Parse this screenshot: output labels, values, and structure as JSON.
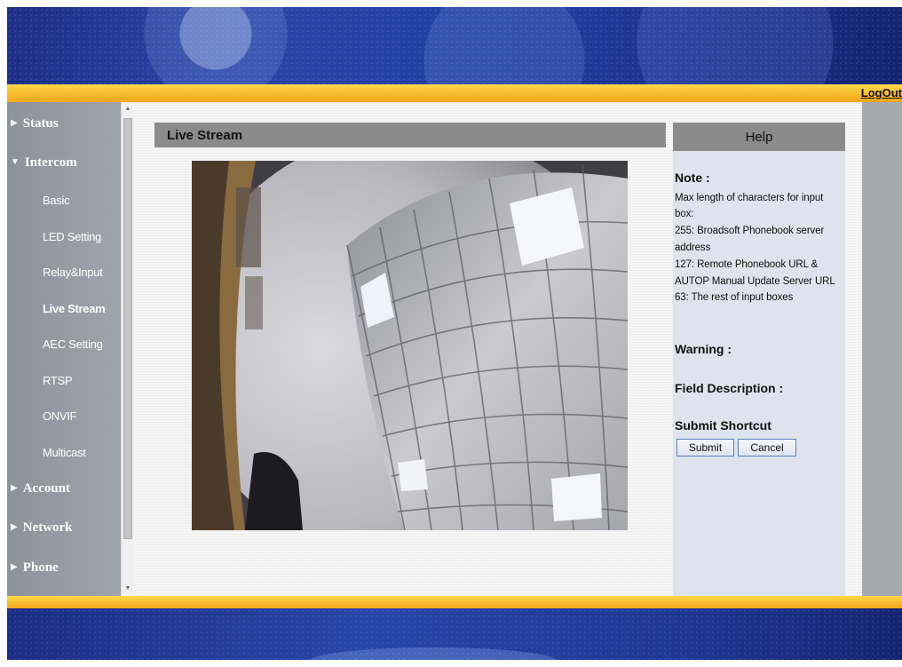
{
  "header": {
    "logout_label": "LogOut"
  },
  "sidebar": {
    "items": [
      {
        "label": "Status",
        "level": "top"
      },
      {
        "label": "Intercom",
        "level": "top",
        "expanded": true
      },
      {
        "label": "Basic",
        "level": "sub"
      },
      {
        "label": "LED Setting",
        "level": "sub"
      },
      {
        "label": "Relay&Input",
        "level": "sub"
      },
      {
        "label": "Live Stream",
        "level": "sub",
        "active": true
      },
      {
        "label": "AEC Setting",
        "level": "sub"
      },
      {
        "label": "RTSP",
        "level": "sub"
      },
      {
        "label": "ONVIF",
        "level": "sub"
      },
      {
        "label": "Multicast",
        "level": "sub"
      },
      {
        "label": "Account",
        "level": "top"
      },
      {
        "label": "Network",
        "level": "top"
      },
      {
        "label": "Phone",
        "level": "top"
      }
    ]
  },
  "main": {
    "section_title": "Live Stream"
  },
  "help": {
    "title": "Help",
    "note_heading": "Note :",
    "note_lines": [
      "Max length of characters for input",
      "box:",
      "255: Broadsoft Phonebook server",
      "address",
      "127: Remote Phonebook URL &",
      "AUTOP Manual Update Server URL",
      "63: The rest of input boxes"
    ],
    "warning_heading": "Warning :",
    "field_desc_heading": "Field Description :",
    "submit_shortcut_heading": "Submit Shortcut",
    "submit_label": "Submit",
    "cancel_label": "Cancel"
  },
  "colors": {
    "accent_yellow": "#f5b41f",
    "sidebar_gray": "#979ba2",
    "help_panel_bg": "#dde4ee",
    "header_gray": "#8b8b8b"
  }
}
